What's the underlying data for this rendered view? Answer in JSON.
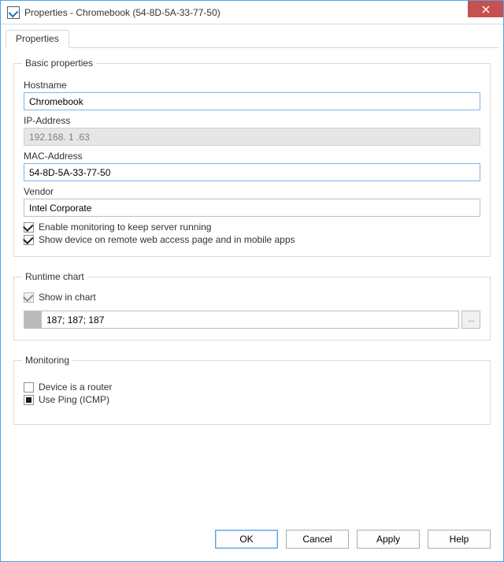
{
  "window": {
    "title": "Properties - Chromebook (54-8D-5A-33-77-50)"
  },
  "tabs": {
    "properties": "Properties"
  },
  "groups": {
    "basic": "Basic properties",
    "runtime": "Runtime chart",
    "monitoring": "Monitoring"
  },
  "basic": {
    "hostname_label": "Hostname",
    "hostname_value": "Chromebook",
    "ip_label": "IP-Address",
    "ip_value": "192.168. 1 .63",
    "mac_label": "MAC-Address",
    "mac_value": "54-8D-5A-33-77-50",
    "vendor_label": "Vendor",
    "vendor_value": "Intel Corporate",
    "enable_monitoring_label": "Enable monitoring to keep server running",
    "show_device_label": "Show device on remote web access page and in mobile apps"
  },
  "runtime": {
    "show_in_chart_label": "Show in chart",
    "color_text": "187; 187; 187",
    "ellipsis": "..."
  },
  "monitoring": {
    "router_label": "Device is a router",
    "ping_label": "Use Ping (ICMP)"
  },
  "buttons": {
    "ok": "OK",
    "cancel": "Cancel",
    "apply": "Apply",
    "help": "Help"
  }
}
